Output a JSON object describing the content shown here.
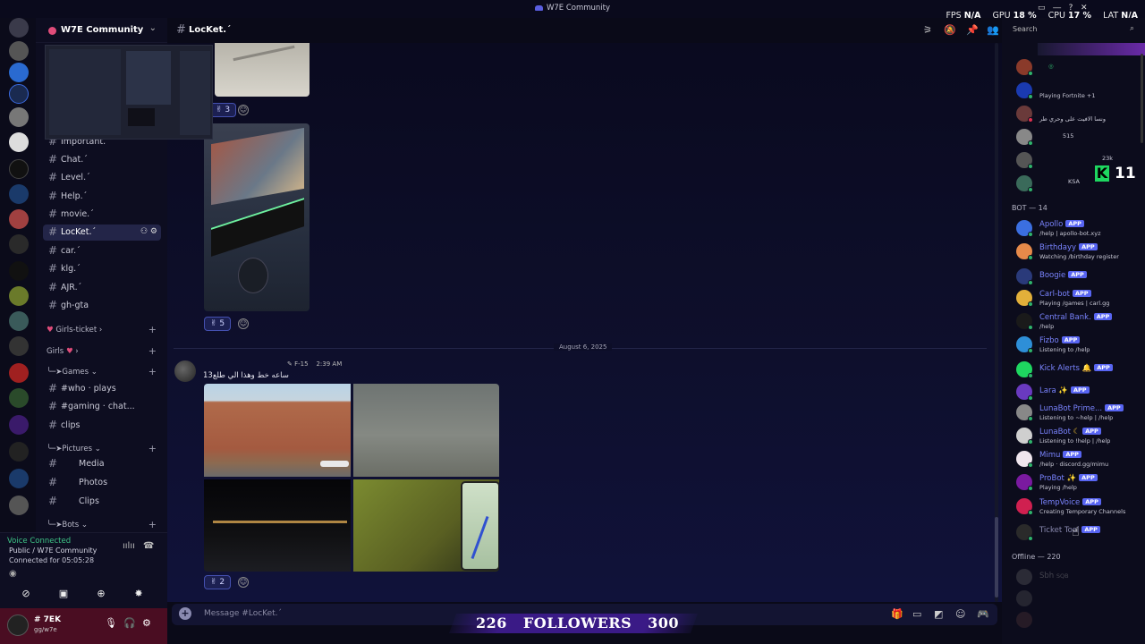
{
  "window": {
    "title": "W7E Community"
  },
  "stats": {
    "fps_label": "FPS",
    "fps": "N/A",
    "gpu_label": "GPU",
    "gpu": "18 %",
    "cpu_label": "CPU",
    "cpu": "17 %",
    "lat_label": "LAT",
    "lat": "N/A"
  },
  "server": {
    "name": "W7E Community"
  },
  "channels": [
    {
      "label": "Important.´"
    },
    {
      "label": "Chat.´"
    },
    {
      "label": "Level.´"
    },
    {
      "label": "Help.´"
    },
    {
      "label": "movie.´"
    },
    {
      "label": "LocKet.´"
    },
    {
      "label": "car.´"
    },
    {
      "label": "klg.´"
    },
    {
      "label": "AJR.´"
    },
    {
      "label": "gh-gta"
    }
  ],
  "categories": {
    "girls_ticket": "Girls-ticket",
    "girls": "Girls",
    "games": "Games",
    "pictures": "Pictures",
    "bots": "Bots"
  },
  "sub_channels": {
    "who_plays": "#who · plays",
    "gaming_chat": "#gaming · chat...",
    "clips_gif": "clips",
    "media": "Media",
    "photos": "Photos",
    "clips": "Clips"
  },
  "voice": {
    "status": "Voice Connected",
    "channel": "Public / W7E Community",
    "connected_label": "Connected for 05:05:28"
  },
  "user": {
    "name": "# 7EK",
    "status": "gg/w7e"
  },
  "chat": {
    "channel": "LocKet.´",
    "reaction_counts": [
      "3",
      "5",
      "2"
    ],
    "date_divider": "August 6, 2025",
    "message_tag": "F-15",
    "message_time": "2:39 AM",
    "message_text": "13ساعه خط وهذا الي طلع",
    "placeholder": "Message #LocKet.´"
  },
  "overlay": {
    "followers_current": "226",
    "followers_label": "FOLLOWERS",
    "followers_goal": "300"
  },
  "members": {
    "search_placeholder": "Search",
    "top_rows": [
      {
        "sub": ""
      },
      {
        "sub": "Playing Fortnite +1"
      },
      {
        "sub": "ونسا الافيت على وحري طر"
      },
      {
        "sub": "515"
      },
      {
        "sub": "23k"
      },
      {
        "sub": "KSA"
      }
    ],
    "k_number": "11",
    "bot_header": "BOT — 14",
    "bots": [
      {
        "name": "Apollo",
        "tag": "APP",
        "sub": "/help | apollo-bot.xyz",
        "color": "#3b6fe0"
      },
      {
        "name": "Birthdayy",
        "tag": "APP",
        "sub": "Watching /birthday register",
        "color": "#e68a4a"
      },
      {
        "name": "Boogie",
        "tag": "APP",
        "sub": "",
        "color": "#2a3a7a"
      },
      {
        "name": "Carl-bot",
        "tag": "APP",
        "sub": "Playing /games | carl.gg",
        "color": "#e2b03a"
      },
      {
        "name": "Central Bank.",
        "tag": "APP",
        "sub": "/help",
        "color": "#1a1a1a"
      },
      {
        "name": "Fizbo",
        "tag": "APP",
        "sub": "Listening to /help",
        "color": "#2e8fd8"
      },
      {
        "name": "Kick Alerts",
        "tag": "APP",
        "sub": "",
        "color": "#1ed760"
      },
      {
        "name": "Lara",
        "tag": "APP",
        "sub": "",
        "color": "#6a3ac0"
      },
      {
        "name": "LunaBot Prime...",
        "tag": "APP",
        "sub": "Listening to ~help | /help",
        "color": "#888888"
      },
      {
        "name": "LunaBot",
        "tag": "APP",
        "sub": "Listening to !help | /help",
        "color": "#cfcfcf"
      },
      {
        "name": "Mimu",
        "tag": "APP",
        "sub": "/help · discord.gg/mimu",
        "color": "#f0e6ee"
      },
      {
        "name": "ProBot",
        "tag": "APP",
        "sub": "Playing /help",
        "color": "#7a1aa0"
      },
      {
        "name": "TempVoice",
        "tag": "APP",
        "sub": "Creating Temporary Channels",
        "color": "#d02050"
      },
      {
        "name": "Ticket Tool",
        "tag": "APP",
        "sub": "",
        "color": "#2a2a2a"
      }
    ],
    "offline_header": "Offline — 220",
    "offline_rows": [
      {
        "name": "Sbh",
        "sub": "SQB"
      }
    ]
  }
}
